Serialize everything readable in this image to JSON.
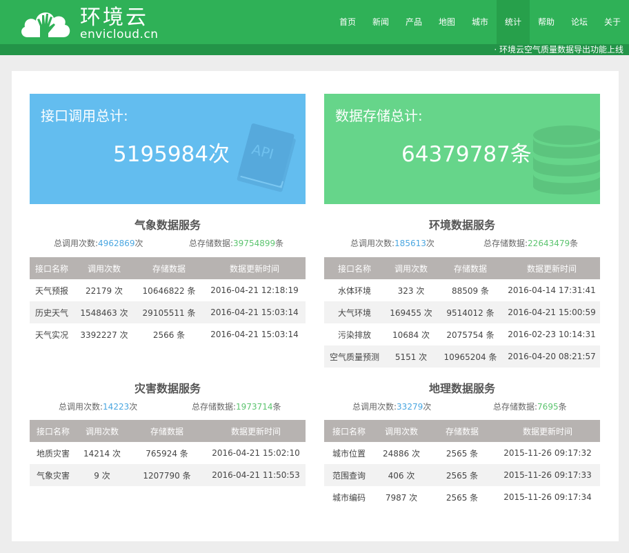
{
  "brand": {
    "name": "环境云",
    "domain": "envicloud.cn"
  },
  "nav": [
    "首页",
    "新闻",
    "产品",
    "地图",
    "城市",
    "统计",
    "帮助",
    "论坛",
    "关于"
  ],
  "nav_active": "统计",
  "ticker": "· 环境云空气质量数据导出功能上线",
  "stats": {
    "calls": {
      "label": "接口调用总计:",
      "value": "5195984次",
      "icon_text": "API",
      "color": "#63bdef"
    },
    "storage": {
      "label": "数据存储总计:",
      "value": "64379787条",
      "color": "#66d58a"
    }
  },
  "columns": [
    "接口名称",
    "调用次数",
    "存储数据",
    "数据更新时间"
  ],
  "labels": {
    "calls": "总调用次数:",
    "storage": "总存储数据:",
    "times_unit": "次",
    "rows_unit": "条"
  },
  "sections": [
    {
      "title": "气象数据服务",
      "total_calls": "4962869",
      "total_storage": "39754899",
      "rows": [
        {
          "name": "天气预报",
          "calls": "22179 次",
          "storage": "10646822 条",
          "updated": "2016-04-21 12:18:19"
        },
        {
          "name": "历史天气",
          "calls": "1548463 次",
          "storage": "29105511 条",
          "updated": "2016-04-21 15:03:14"
        },
        {
          "name": "天气实况",
          "calls": "3392227 次",
          "storage": "2566 条",
          "updated": "2016-04-21 15:03:14"
        }
      ]
    },
    {
      "title": "环境数据服务",
      "total_calls": "185613",
      "total_storage": "22643479",
      "rows": [
        {
          "name": "水体环境",
          "calls": "323 次",
          "storage": "88509 条",
          "updated": "2016-04-14 17:31:41"
        },
        {
          "name": "大气环境",
          "calls": "169455 次",
          "storage": "9514012 条",
          "updated": "2016-04-21 15:00:59"
        },
        {
          "name": "污染排放",
          "calls": "10684 次",
          "storage": "2075754 条",
          "updated": "2016-02-23 10:14:31"
        },
        {
          "name": "空气质量预测",
          "calls": "5151 次",
          "storage": "10965204 条",
          "updated": "2016-04-20 08:21:57"
        }
      ]
    },
    {
      "title": "灾害数据服务",
      "total_calls": "14223",
      "total_storage": "1973714",
      "rows": [
        {
          "name": "地质灾害",
          "calls": "14214 次",
          "storage": "765924 条",
          "updated": "2016-04-21 15:02:10"
        },
        {
          "name": "气象灾害",
          "calls": "9 次",
          "storage": "1207790 条",
          "updated": "2016-04-21 11:50:53"
        }
      ]
    },
    {
      "title": "地理数据服务",
      "total_calls": "33279",
      "total_storage": "7695",
      "rows": [
        {
          "name": "城市位置",
          "calls": "24886 次",
          "storage": "2565 条",
          "updated": "2015-11-26 09:17:32"
        },
        {
          "name": "范围查询",
          "calls": "406 次",
          "storage": "2565 条",
          "updated": "2015-11-26 09:17:33"
        },
        {
          "name": "城市编码",
          "calls": "7987 次",
          "storage": "2565 条",
          "updated": "2015-11-26 09:17:34"
        }
      ]
    }
  ]
}
